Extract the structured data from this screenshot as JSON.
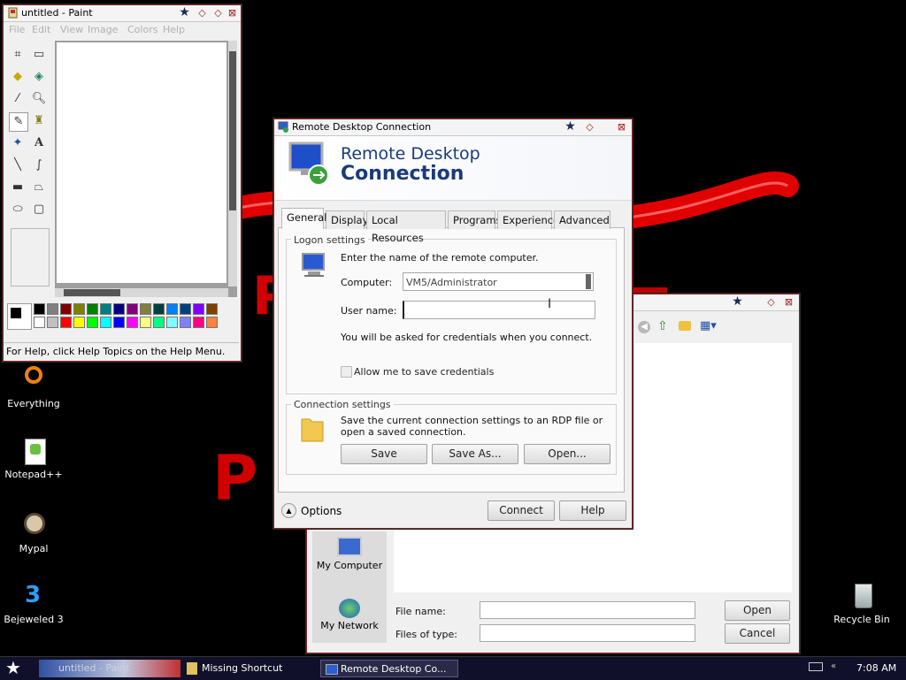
{
  "paint": {
    "title": "untitled - Paint",
    "menu": [
      "File",
      "Edit",
      "View",
      "Image",
      "Colors",
      "Help"
    ],
    "status": "For Help, click Help Topics on the Help Menu.",
    "palette_top": [
      "#000000",
      "#808080",
      "#800000",
      "#808000",
      "#008000",
      "#008080",
      "#000080",
      "#800080",
      "#808040",
      "#004040",
      "#0080ff",
      "#004080",
      "#8000ff",
      "#804000"
    ],
    "palette_bottom": [
      "#ffffff",
      "#c0c0c0",
      "#ff0000",
      "#ffff00",
      "#00ff00",
      "#00ffff",
      "#0000ff",
      "#ff00ff",
      "#ffff80",
      "#00ff80",
      "#80ffff",
      "#8080ff",
      "#ff0080",
      "#ff8040"
    ]
  },
  "rdc": {
    "title": "Remote Desktop Connection",
    "header_line1": "Remote Desktop",
    "header_line2": "Connection",
    "tabs": [
      "General",
      "Display",
      "Local Resources",
      "Programs",
      "Experience",
      "Advanced"
    ],
    "logon_group": "Logon settings",
    "logon_prompt": "Enter the name of the remote computer.",
    "computer_label": "Computer:",
    "computer_value": "VM5/Administrator",
    "username_label": "User name:",
    "username_value": "",
    "credentials_note": "You will be asked for credentials when you connect.",
    "save_credentials_label": "Allow me to save credentials",
    "connection_group": "Connection settings",
    "connection_text": "Save the current connection settings to an RDP file or open a saved connection.",
    "save_label": "Save",
    "save_as_label": "Save As...",
    "open_label": "Open...",
    "options_label": "Options",
    "connect_label": "Connect",
    "help_label": "Help"
  },
  "open_dialog": {
    "places": [
      "My Computer",
      "My Network"
    ],
    "file_name_label": "File name:",
    "files_type_label": "Files of type:",
    "open_label": "Open",
    "cancel_label": "Cancel"
  },
  "desktop": {
    "icons": [
      "Everything",
      "Notepad++",
      "Mypal",
      "Bejeweled 3",
      "Recycle Bin"
    ]
  },
  "taskbar": {
    "tasks": [
      "untitled - Paint",
      "Missing Shortcut",
      "Remote Desktop Co..."
    ],
    "clock": "7:08 AM"
  }
}
